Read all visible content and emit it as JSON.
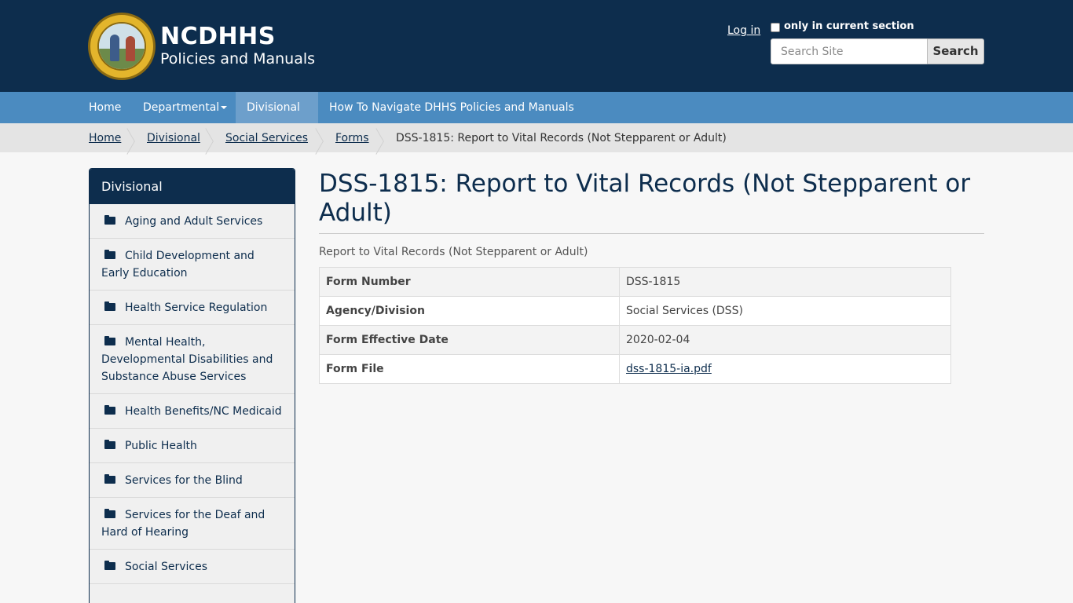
{
  "header": {
    "brand_title": "NCDHHS",
    "brand_subtitle": "Policies and Manuals",
    "login_label": "Log in",
    "current_section_label": "only in current section",
    "search_placeholder": "Search Site",
    "search_button": "Search"
  },
  "nav": {
    "items": [
      {
        "label": "Home"
      },
      {
        "label": "Departmental"
      },
      {
        "label": "Divisional"
      },
      {
        "label": "How To Navigate DHHS Policies and Manuals"
      }
    ]
  },
  "breadcrumb": {
    "items": [
      {
        "label": "Home"
      },
      {
        "label": "Divisional"
      },
      {
        "label": "Social Services"
      },
      {
        "label": "Forms"
      },
      {
        "label": "DSS-1815: Report to Vital Records (Not Stepparent or Adult)"
      }
    ]
  },
  "sidebar": {
    "title": "Divisional",
    "items": [
      {
        "label": "Aging and Adult Services"
      },
      {
        "label": "Child Development and Early Education"
      },
      {
        "label": "Health Service Regulation"
      },
      {
        "label": "Mental Health, Developmental Disabilities and Substance Abuse Services"
      },
      {
        "label": "Health Benefits/NC Medicaid"
      },
      {
        "label": "Public Health"
      },
      {
        "label": "Services for the Blind"
      },
      {
        "label": "Services for the Deaf and Hard of Hearing"
      },
      {
        "label": "Social Services"
      }
    ]
  },
  "main": {
    "title": "DSS-1815: Report to Vital Records (Not Stepparent or Adult)",
    "description": "Report to Vital Records (Not Stepparent or Adult)",
    "table": [
      {
        "label": "Form Number",
        "value": "DSS-1815"
      },
      {
        "label": "Agency/Division",
        "value": "Social Services (DSS)"
      },
      {
        "label": "Form Effective Date",
        "value": "2020-02-04"
      },
      {
        "label": "Form File",
        "value": "dss-1815-ia.pdf"
      }
    ]
  },
  "colors": {
    "header_bg": "#0d2d4d",
    "nav_bg": "#4b8bc0",
    "breadcrumb_bg": "#e4e4e4"
  }
}
